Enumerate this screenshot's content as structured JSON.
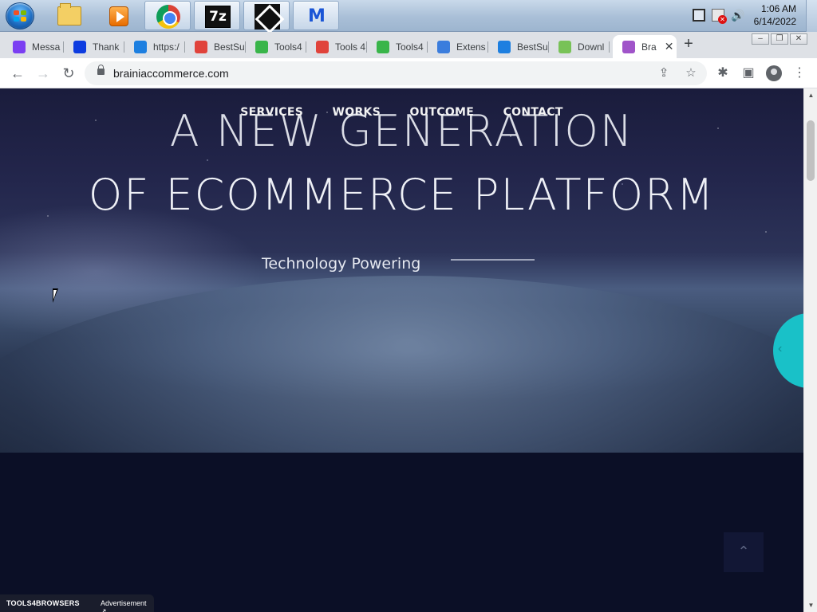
{
  "taskbar": {
    "apps": [
      {
        "name": "Windows Explorer"
      },
      {
        "name": "Windows Media Player"
      },
      {
        "name": "Google Chrome"
      },
      {
        "name": "7-Zip",
        "icon_text": "7z"
      },
      {
        "name": "Mighty Cursor"
      },
      {
        "name": "Malwarebytes",
        "icon_text": "M"
      }
    ],
    "clock_time": "1:06 AM",
    "clock_date": "6/14/2022"
  },
  "browser": {
    "tabs": [
      {
        "label": "Messa",
        "favicon_color": "#7b3ff2"
      },
      {
        "label": "Thank",
        "favicon_color": "#0d3ce0"
      },
      {
        "label": "https:/",
        "favicon_color": "#1d7fe0"
      },
      {
        "label": "BestSu",
        "favicon_color": "#e0433b"
      },
      {
        "label": "Tools4",
        "favicon_color": "#39b54a"
      },
      {
        "label": "Tools 4",
        "favicon_color": "#e0433b"
      },
      {
        "label": "Tools4",
        "favicon_color": "#39b54a"
      },
      {
        "label": "Extens",
        "favicon_color": "#3b7ddd"
      },
      {
        "label": "BestSu",
        "favicon_color": "#1d7fe0"
      },
      {
        "label": "Downl",
        "favicon_color": "#78c257"
      },
      {
        "label": "Bra",
        "favicon_color": "#a054c9",
        "active": true
      }
    ],
    "url": "brainiaccommerce.com"
  },
  "page": {
    "nav": [
      "SERVICES",
      "WORKS",
      "OUTCOME",
      "CONTACT"
    ],
    "headline_line1": "A NEW GENERATION",
    "headline_line2": "OF ECOMMERCE PLATFORM",
    "tagline": "Technology Powering",
    "accent_color": "#19c1c8",
    "ad_brand": "TOOLS4BROWSERS",
    "ad_label": "Advertisement ↗"
  }
}
